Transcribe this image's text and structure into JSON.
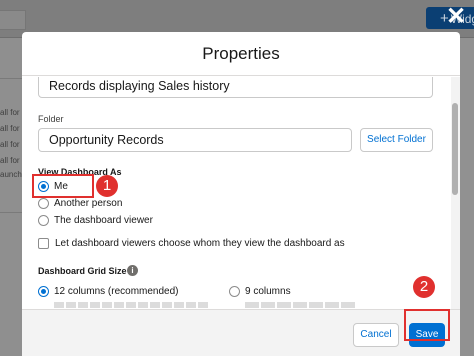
{
  "background": {
    "button_label": "Widg",
    "side_texts": [
      "all for c",
      "all for e",
      "all for le",
      "all for r",
      "aunch a"
    ]
  },
  "modal": {
    "title": "Properties",
    "name_value": "Records displaying Sales history",
    "folder": {
      "label": "Folder",
      "value": "Opportunity Records",
      "button": "Select Folder"
    },
    "view_as": {
      "label": "View Dashboard As",
      "options": [
        "Me",
        "Another person",
        "The dashboard viewer"
      ],
      "selected": "Me",
      "checkbox_label": "Let dashboard viewers choose whom they view the dashboard as"
    },
    "grid_size": {
      "label": "Dashboard Grid Size",
      "info_glyph": "i",
      "options": [
        "12 columns (recommended)",
        "9 columns"
      ],
      "selected": "12 columns (recommended)"
    },
    "footer": {
      "cancel": "Cancel",
      "save": "Save"
    }
  },
  "annotations": {
    "callout_1": "1",
    "callout_2": "2",
    "color": "#e0302e"
  },
  "colors": {
    "accent": "#0070d2",
    "overlay": "#8f8f8f"
  }
}
